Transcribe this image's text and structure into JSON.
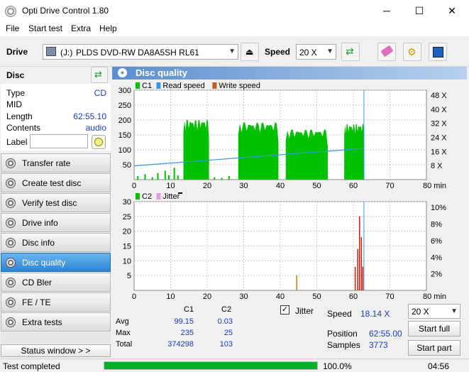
{
  "window": {
    "title": "Opti Drive Control 1.80",
    "minimize": "─",
    "maximize": "☐",
    "close": "✕"
  },
  "menu": [
    "File",
    "Start test",
    "Extra",
    "Help"
  ],
  "toolbar": {
    "drive_label": "Drive",
    "drive_letter": "(J:)",
    "drive_name": "PLDS DVD-RW DA8A5SH RL61",
    "speed_label": "Speed",
    "speed_value": "20 X"
  },
  "disc": {
    "header": "Disc",
    "type_label": "Type",
    "type_value": "CD",
    "mid_label": "MID",
    "mid_value": "",
    "length_label": "Length",
    "length_value": "62:55.10",
    "contents_label": "Contents",
    "contents_value": "audio",
    "label_label": "Label",
    "label_value": ""
  },
  "nav": [
    {
      "label": "Transfer rate",
      "active": false
    },
    {
      "label": "Create test disc",
      "active": false
    },
    {
      "label": "Verify test disc",
      "active": false
    },
    {
      "label": "Drive info",
      "active": false
    },
    {
      "label": "Disc info",
      "active": false
    },
    {
      "label": "Disc quality",
      "active": true
    },
    {
      "label": "CD Bler",
      "active": false
    },
    {
      "label": "FE / TE",
      "active": false
    },
    {
      "label": "Extra tests",
      "active": false
    }
  ],
  "status_window_label": "Status window > >",
  "panel_title": "Disc quality",
  "chart_data": [
    {
      "type": "bar",
      "legend": [
        {
          "name": "C1",
          "color": "#00c000"
        },
        {
          "name": "Read speed",
          "color": "#3c96e6"
        },
        {
          "name": "Write speed",
          "color": "#c06020"
        }
      ],
      "x_ticks": [
        0,
        10,
        20,
        30,
        40,
        50,
        60,
        70,
        80
      ],
      "x_unit": "min",
      "xlim": [
        0,
        80
      ],
      "y_ticks": [
        50,
        100,
        150,
        200,
        250,
        300
      ],
      "ylim": [
        0,
        300
      ],
      "y2_ticks": [
        "8 X",
        "16 X",
        "24 X",
        "32 X",
        "40 X",
        "48 X"
      ],
      "y2lim": [
        0,
        52
      ],
      "c1_blocks": [
        {
          "x": [
            13.5,
            20.5
          ],
          "top": 210
        },
        {
          "x": [
            28.5,
            39.5
          ],
          "top": 200
        },
        {
          "x": [
            41.5,
            53.0
          ],
          "top": 175
        },
        {
          "x": [
            57.5,
            63.0
          ],
          "top": 195
        }
      ],
      "c1_small": [
        [
          1,
          12
        ],
        [
          3,
          18
        ],
        [
          5,
          8
        ],
        [
          6.5,
          22
        ],
        [
          8.5,
          30
        ],
        [
          9.5,
          15
        ],
        [
          11,
          40
        ],
        [
          12,
          14
        ],
        [
          22,
          8
        ],
        [
          24,
          6
        ],
        [
          26,
          12
        ]
      ],
      "read_speed": [
        [
          0,
          8.0
        ],
        [
          62.9,
          18.14
        ]
      ],
      "grid": true
    },
    {
      "type": "bar",
      "legend": [
        {
          "name": "C2",
          "color": "#00c000"
        },
        {
          "name": "Jitter",
          "color": "#e0a0e0"
        }
      ],
      "x_ticks": [
        0,
        10,
        20,
        30,
        40,
        50,
        60,
        70,
        80
      ],
      "x_unit": "min",
      "xlim": [
        0,
        80
      ],
      "y_ticks": [
        5,
        10,
        15,
        20,
        25,
        30
      ],
      "ylim": [
        0,
        30
      ],
      "y2_ticks": [
        "2%",
        "4%",
        "6%",
        "8%",
        "10%"
      ],
      "y2lim": [
        0,
        11.5
      ],
      "c2_spikes": [
        [
          44.5,
          5
        ],
        [
          60.5,
          8
        ],
        [
          61.2,
          14
        ],
        [
          61.7,
          25
        ],
        [
          62.2,
          18
        ],
        [
          62.6,
          8
        ]
      ],
      "grid": true
    }
  ],
  "stats": {
    "col_c1": "C1",
    "col_c2": "C2",
    "avg_label": "Avg",
    "avg_c1": "99.15",
    "avg_c2": "0.03",
    "max_label": "Max",
    "max_c1": "235",
    "max_c2": "25",
    "total_label": "Total",
    "total_c1": "374298",
    "total_c2": "103",
    "jitter_label": "Jitter",
    "speed_label": "Speed",
    "speed_value": "18.14 X",
    "position_label": "Position",
    "position_value": "62:55.00",
    "samples_label": "Samples",
    "samples_value": "3773",
    "speed_select": "20 X",
    "start_full": "Start full",
    "start_part": "Start part"
  },
  "status": {
    "text": "Test completed",
    "progress": 1.0,
    "progress_text": "100.0%",
    "time": "04:56"
  }
}
